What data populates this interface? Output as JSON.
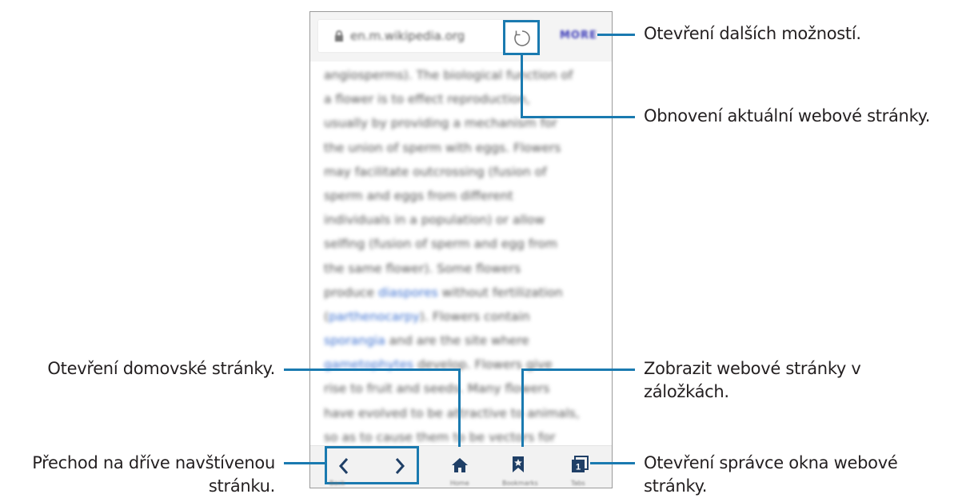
{
  "browser": {
    "url": "en.m.wikipedia.org",
    "more_label": "MORE",
    "article_lines": [
      [
        "angiosperms). The biological function of"
      ],
      [
        "a flower is to effect reproduction,"
      ],
      [
        "usually by providing a mechanism for"
      ],
      [
        "the union of sperm with eggs. Flowers"
      ],
      [
        "may facilitate outcrossing (fusion of"
      ],
      [
        "sperm and eggs from different"
      ],
      [
        "individuals in a population) or allow"
      ],
      [
        "selfing (fusion of sperm and egg from"
      ],
      [
        "the same flower). Some flowers"
      ],
      [
        "produce ",
        "diaspores",
        " without fertilization"
      ],
      [
        "(",
        "parthenocarpy",
        "). Flowers contain"
      ],
      [
        "",
        "sporangia",
        " and are the site where"
      ],
      [
        "",
        "gametophytes",
        " develop. Flowers give"
      ],
      [
        "rise to fruit and seeds. Many flowers"
      ],
      [
        "have evolved to be attractive to animals,"
      ],
      [
        "so as to cause them to be vectors for"
      ]
    ],
    "bottom_labels": {
      "back": "Back",
      "home": "Home",
      "bookmarks": "Bookmarks",
      "tabs": "Tabs"
    },
    "tab_count": "1"
  },
  "callouts": {
    "more_options": "Otevření dalších možností.",
    "refresh": "Obnovení aktuální webové stránky.",
    "home": "Otevření domovské stránky.",
    "bookmarks_line1": "Zobrazit webové stránky v",
    "bookmarks_line2": "záložkách.",
    "nav_line1": "Přechod na dříve navštívenou",
    "nav_line2": "stránku.",
    "tabs_line1": "Otevření správce okna webové",
    "tabs_line2": "stránky."
  },
  "colors": {
    "accent": "#1a7ab0",
    "icon": "#1f3f66",
    "link": "#3a6fd0"
  }
}
